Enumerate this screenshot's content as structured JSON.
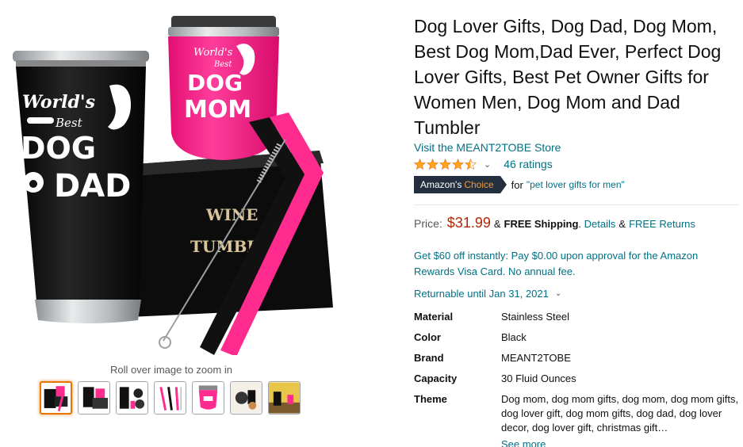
{
  "gallery": {
    "main_image_texts": {
      "dad_tumbler_top": "World's",
      "dad_tumbler_mid": "Best",
      "dad_tumbler_dog": "DOG",
      "dad_tumbler_dad": "DAD",
      "mom_tumbler_top": "World's",
      "mom_tumbler_mid": "Best",
      "mom_tumbler_dog": "DOG",
      "mom_tumbler_mom": "MOM",
      "box_line1": "WINE",
      "box_line2": "TUMBL"
    },
    "zoom_hint": "Roll over image to zoom in",
    "thumbnails": [
      {
        "selected": true
      },
      {
        "selected": false
      },
      {
        "selected": false
      },
      {
        "selected": false
      },
      {
        "selected": false
      },
      {
        "selected": false
      },
      {
        "selected": false
      }
    ]
  },
  "product": {
    "title": "Dog Lover Gifts, Dog Dad, Dog Mom, Best Dog Mom,Dad Ever, Perfect Dog Lover Gifts, Best Pet Owner Gifts for Women Men, Dog Mom and Dad Tumbler",
    "store_link": "Visit the MEANT2TOBE Store",
    "rating_stars": 4.5,
    "ratings_count": "46 ratings",
    "badge_prefix": "Amazon's",
    "badge_accent": "Choice",
    "choice_for": "for",
    "choice_keyword": "\"pet lover gifts for men\"",
    "price_label": "Price:",
    "price": "$31.99",
    "amp": "&",
    "free_shipping": "FREE Shipping",
    "details_link": "Details",
    "free_returns": "FREE Returns",
    "promo": "Get $60 off instantly: Pay $0.00 upon approval for the Amazon Rewards Visa Card. No annual fee.",
    "returnable": "Returnable until Jan 31, 2021",
    "specs": [
      {
        "key": "Material",
        "value": "Stainless Steel"
      },
      {
        "key": "Color",
        "value": "Black"
      },
      {
        "key": "Brand",
        "value": "MEANT2TOBE"
      },
      {
        "key": "Capacity",
        "value": "30 Fluid Ounces"
      },
      {
        "key": "Theme",
        "value": "Dog mom, dog mom gifts, dog mom, dog mom gifts, dog lover gift, dog mom gifts, dog dad, dog lover decor, dog lover gift, christmas gift…"
      }
    ],
    "see_more": "See more"
  },
  "colors": {
    "link": "#007185",
    "price": "#b12704",
    "badge_bg": "#232f3e",
    "badge_accent": "#f69931",
    "star": "#ffa41c",
    "thumb_selected": "#e77600",
    "tumbler_pink": "#ff1f8a",
    "tumbler_black": "#141414"
  }
}
